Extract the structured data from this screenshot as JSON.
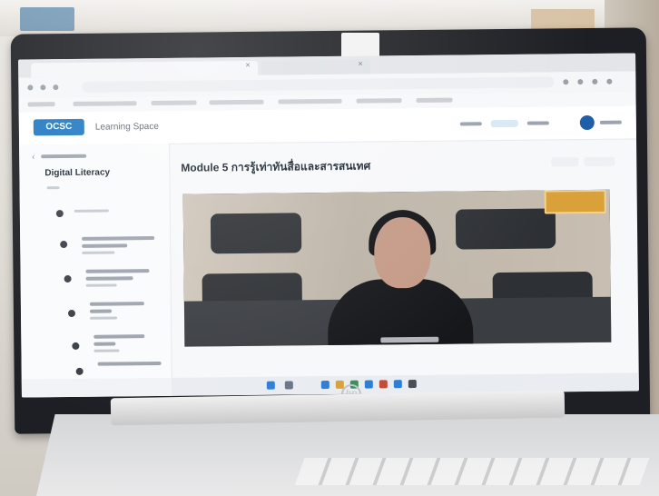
{
  "app": {
    "logo_text": "OCSC",
    "brand": "Learning Space"
  },
  "sidebar": {
    "course_title": "Digital Literacy"
  },
  "main": {
    "module_title": "Module 5 การรู้เท่าทันสื่อและสารสนเทศ"
  },
  "device": {
    "logo": "hp"
  },
  "colors": {
    "brand": "#1f78c1",
    "video_badge": "#d9a13a"
  }
}
